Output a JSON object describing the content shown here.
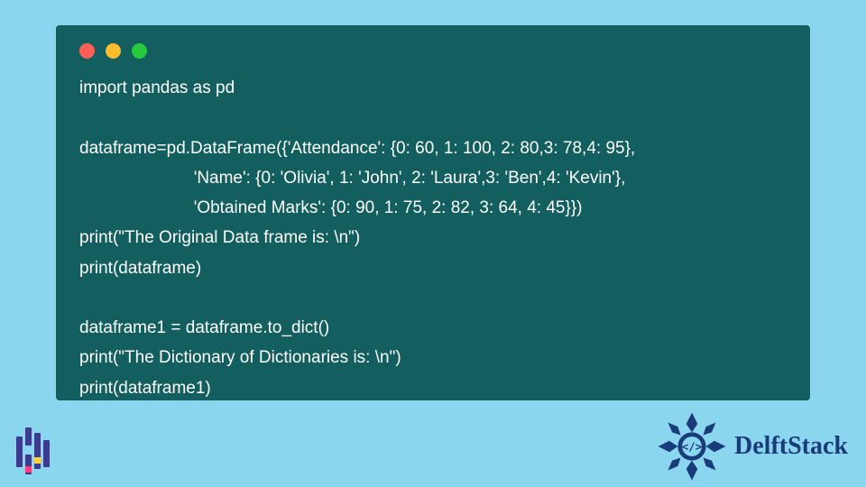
{
  "code": {
    "lines": [
      "import pandas as pd",
      "",
      "dataframe=pd.DataFrame({'Attendance': {0: 60, 1: 100, 2: 80,3: 78,4: 95},",
      "                        'Name': {0: 'Olivia', 1: 'John', 2: 'Laura',3: 'Ben',4: 'Kevin'},",
      "                        'Obtained Marks': {0: 90, 1: 75, 2: 82, 3: 64, 4: 45}})",
      "print(\"The Original Data frame is: \\n\")",
      "print(dataframe)",
      "",
      "dataframe1 = dataframe.to_dict()",
      "print(\"The Dictionary of Dictionaries is: \\n\")",
      "print(dataframe1)"
    ]
  },
  "brand": {
    "name": "DelftStack"
  },
  "colors": {
    "page_bg": "#8bd6ef",
    "window_bg": "#135e5e",
    "text": "#ffffff",
    "brand": "#1a3b7a"
  }
}
